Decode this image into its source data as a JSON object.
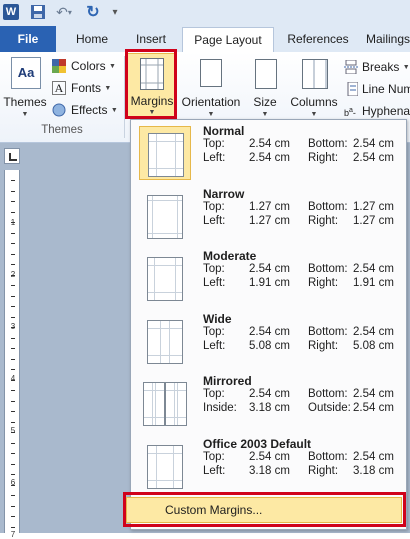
{
  "qat": {
    "app_icon": "word-logo-icon",
    "app_letter": "W"
  },
  "tabs": [
    {
      "label": "File"
    },
    {
      "label": "Home"
    },
    {
      "label": "Insert"
    },
    {
      "label": "Page Layout"
    },
    {
      "label": "References"
    },
    {
      "label": "Mailings"
    }
  ],
  "ribbon": {
    "themes": "Themes",
    "colors": "Colors",
    "fonts": "Fonts",
    "effects": "Effects",
    "themes_group": "Themes",
    "margins": "Margins",
    "orientation": "Orientation",
    "size": "Size",
    "columns": "Columns",
    "breaks": "Breaks",
    "line_numbers": "Line Num",
    "hyphenation": "Hyphena"
  },
  "ruler": {
    "numbers": [
      "1",
      "2",
      "3",
      "4",
      "5",
      "6",
      "7"
    ]
  },
  "margins_menu": {
    "labels": {
      "top": "Top:",
      "left": "Left:",
      "inside": "Inside:",
      "bottom": "Bottom:",
      "right": "Right:",
      "outside": "Outside:"
    },
    "presets": [
      {
        "name": "Normal",
        "a_label": "Top:",
        "a": "2.54 cm",
        "b_label": "Left:",
        "b": "2.54 cm",
        "c_label": "Bottom:",
        "c": "2.54 cm",
        "d_label": "Right:",
        "d": "2.54 cm"
      },
      {
        "name": "Narrow",
        "a_label": "Top:",
        "a": "1.27 cm",
        "b_label": "Left:",
        "b": "1.27 cm",
        "c_label": "Bottom:",
        "c": "1.27 cm",
        "d_label": "Right:",
        "d": "1.27 cm"
      },
      {
        "name": "Moderate",
        "a_label": "Top:",
        "a": "2.54 cm",
        "b_label": "Left:",
        "b": "1.91 cm",
        "c_label": "Bottom:",
        "c": "2.54 cm",
        "d_label": "Right:",
        "d": "1.91 cm"
      },
      {
        "name": "Wide",
        "a_label": "Top:",
        "a": "2.54 cm",
        "b_label": "Left:",
        "b": "5.08 cm",
        "c_label": "Bottom:",
        "c": "2.54 cm",
        "d_label": "Right:",
        "d": "5.08 cm"
      },
      {
        "name": "Mirrored",
        "a_label": "Top:",
        "a": "2.54 cm",
        "b_label": "Inside:",
        "b": "3.18 cm",
        "c_label": "Bottom:",
        "c": "2.54 cm",
        "d_label": "Outside:",
        "d": "2.54 cm"
      },
      {
        "name": "Office 2003 Default",
        "a_label": "Top:",
        "a": "2.54 cm",
        "b_label": "Left:",
        "b": "3.18 cm",
        "c_label": "Bottom:",
        "c": "2.54 cm",
        "d_label": "Right:",
        "d": "3.18 cm"
      }
    ],
    "custom": "Custom Margins..."
  },
  "colors": {
    "accent": "#2a62b3",
    "highlight": "#fde9a4",
    "annotation": "#d0021b"
  }
}
